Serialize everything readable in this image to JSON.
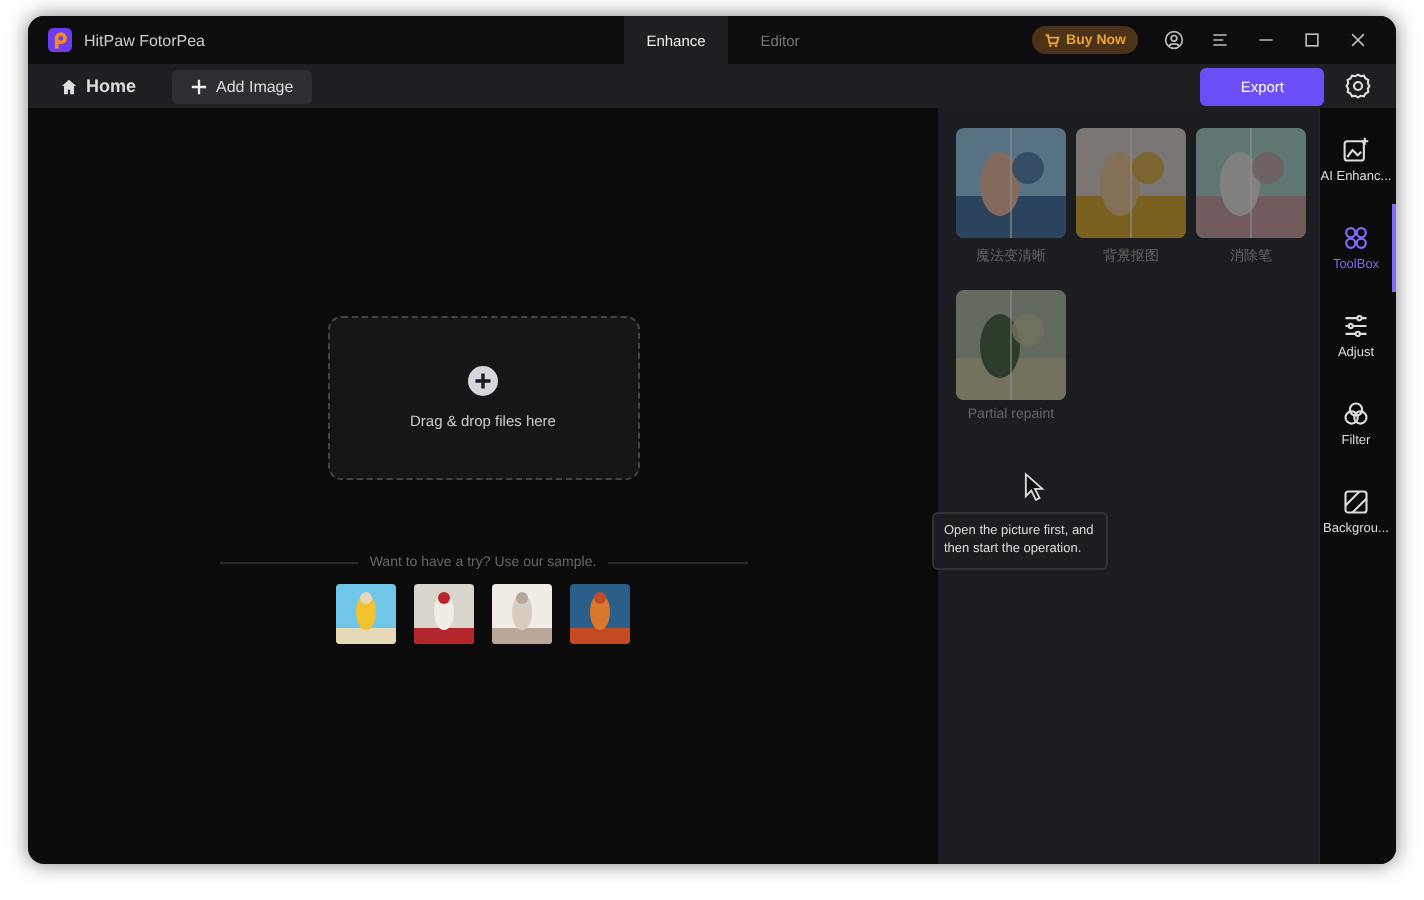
{
  "window": {
    "title": "HitPaw FotorPea"
  },
  "tabs": [
    {
      "label": "Enhance",
      "selected": true
    },
    {
      "label": "Editor",
      "selected": false
    }
  ],
  "buy_now": "Buy Now",
  "toolbar": {
    "home": "Home",
    "add_image": "Add Image",
    "export": "Export"
  },
  "upload": {
    "text": "Drag & drop files here"
  },
  "samples": {
    "text": "Want to have a try? Use our sample."
  },
  "tools": [
    {
      "label": "魔法变清晰",
      "disabled": true
    },
    {
      "label": "背景抠图",
      "disabled": true
    },
    {
      "label": "消除笔",
      "disabled": true
    },
    {
      "label": "Partial repaint",
      "disabled": true
    }
  ],
  "rail": [
    {
      "label": "AI Enhanc...",
      "selected": false
    },
    {
      "label": "ToolBox",
      "selected": true
    },
    {
      "label": "Adjust",
      "selected": false
    },
    {
      "label": "Filter",
      "selected": false
    },
    {
      "label": "Backgrou...",
      "selected": false
    }
  ],
  "tooltip": "Open the picture first, and then start the operation."
}
